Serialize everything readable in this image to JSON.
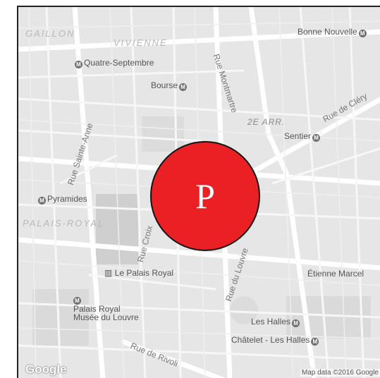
{
  "districts": {
    "gaillon": "GAILLON",
    "vivienne": "VIVIENNE",
    "palais_royal": "PALAIS-ROYAL",
    "arrondissement": "2E ARR."
  },
  "metro": {
    "quatre_septembre": "Quatre-Septembre",
    "bourse": "Bourse",
    "bonne_nouvelle": "Bonne Nouvelle",
    "sentier": "Sentier",
    "pyramides": "Pyramides",
    "palais_royal_louvre": [
      "Palais Royal",
      "Musée du Louvre"
    ],
    "les_halles": "Les Halles",
    "chatelet": "Châtelet - Les Halles"
  },
  "streets": {
    "montmartre": "Rue Montmartre",
    "clery": "Rue de Cléry",
    "sainte_anne": "Rue Sainte-Anne",
    "louvre": "Rue du Louvre",
    "rivoli": "Rue de Rivoli",
    "croix": "Rue Croix"
  },
  "places": {
    "le_palais_royal": "Le Palais Royal",
    "etienne_marcel": "Étienne Marcel"
  },
  "marker": {
    "letter": "P",
    "color": "#ea2024"
  },
  "attribution": {
    "logo": "Google",
    "copyright": "Map data ©2016 Google"
  },
  "colors": {
    "map_bg": "#e6e6e6",
    "road": "#ffffff",
    "block": "#d7d7d7"
  }
}
